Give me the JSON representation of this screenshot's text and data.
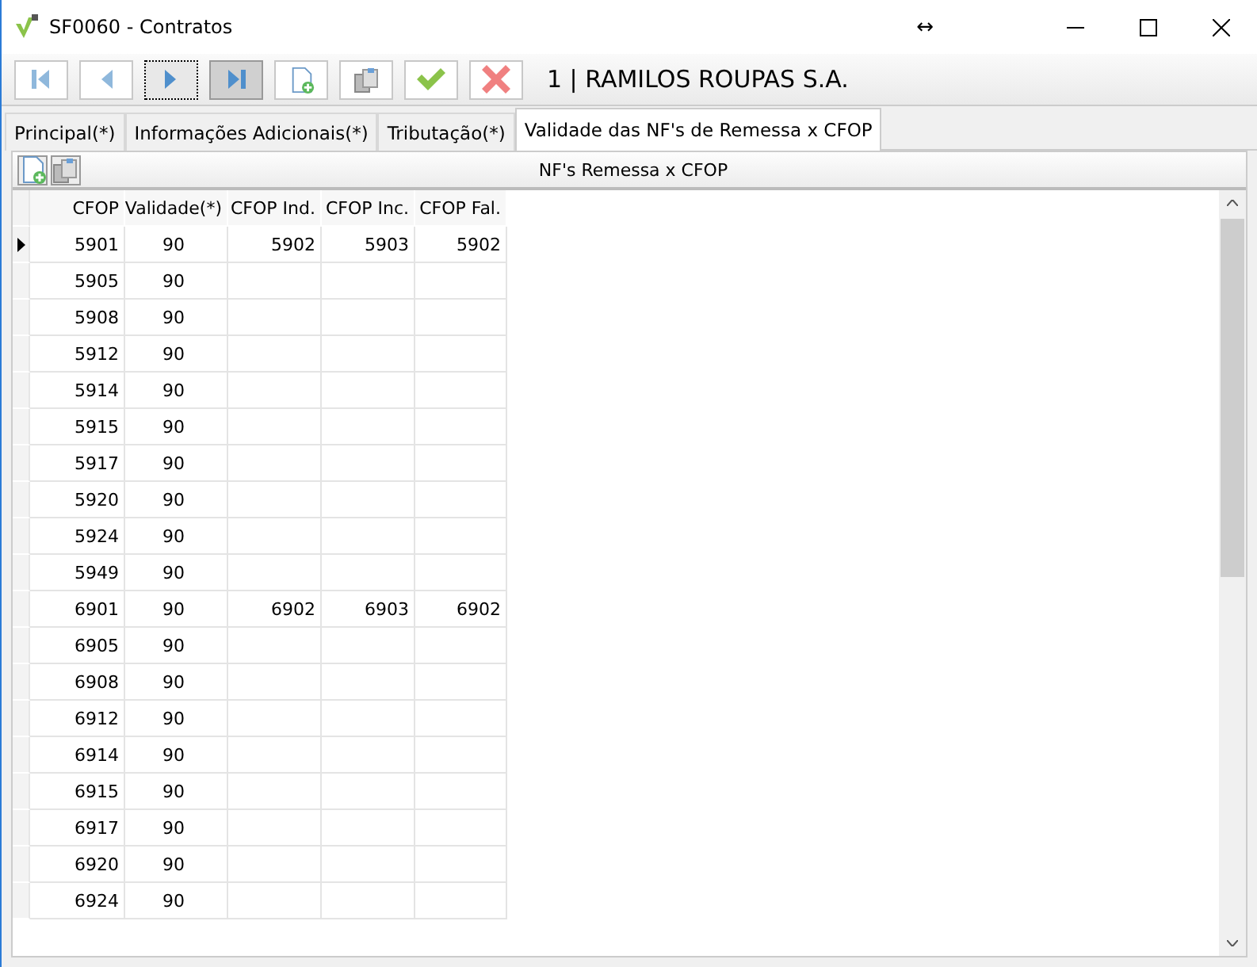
{
  "window": {
    "title": "SF0060 - Contratos",
    "resize_glyph": "↔"
  },
  "toolbar": {
    "buttons": [
      {
        "kind": "first",
        "focused": false,
        "pressed": false
      },
      {
        "kind": "prev",
        "focused": false,
        "pressed": false
      },
      {
        "kind": "next",
        "focused": true,
        "pressed": false
      },
      {
        "kind": "last",
        "focused": false,
        "pressed": true
      },
      {
        "kind": "new",
        "focused": false,
        "pressed": false
      },
      {
        "kind": "copy",
        "focused": false,
        "pressed": false
      },
      {
        "kind": "confirm",
        "focused": false,
        "pressed": false
      },
      {
        "kind": "cancel",
        "focused": false,
        "pressed": false
      }
    ],
    "record": "1 | RAMILOS ROUPAS S.A."
  },
  "tabs": [
    {
      "label": "Principal(*)",
      "selected": false
    },
    {
      "label": "Informações Adicionais(*)",
      "selected": false
    },
    {
      "label": "Tributação(*)",
      "selected": false
    },
    {
      "label": "Validade das NF's de Remessa x CFOP",
      "selected": true
    }
  ],
  "panel": {
    "tools": [
      {
        "kind": "new"
      },
      {
        "kind": "copy"
      }
    ],
    "title": "NF's Remessa x CFOP"
  },
  "table": {
    "columns": [
      "CFOP",
      "Validade(*)",
      "CFOP Ind.",
      "CFOP Inc.",
      "CFOP Fal."
    ],
    "rows": [
      {
        "current": true,
        "cells": [
          "5901",
          "90",
          "5902",
          "5903",
          "5902"
        ]
      },
      {
        "current": false,
        "cells": [
          "5905",
          "90",
          "",
          "",
          ""
        ]
      },
      {
        "current": false,
        "cells": [
          "5908",
          "90",
          "",
          "",
          ""
        ]
      },
      {
        "current": false,
        "cells": [
          "5912",
          "90",
          "",
          "",
          ""
        ]
      },
      {
        "current": false,
        "cells": [
          "5914",
          "90",
          "",
          "",
          ""
        ]
      },
      {
        "current": false,
        "cells": [
          "5915",
          "90",
          "",
          "",
          ""
        ]
      },
      {
        "current": false,
        "cells": [
          "5917",
          "90",
          "",
          "",
          ""
        ]
      },
      {
        "current": false,
        "cells": [
          "5920",
          "90",
          "",
          "",
          ""
        ]
      },
      {
        "current": false,
        "cells": [
          "5924",
          "90",
          "",
          "",
          ""
        ]
      },
      {
        "current": false,
        "cells": [
          "5949",
          "90",
          "",
          "",
          ""
        ]
      },
      {
        "current": false,
        "cells": [
          "6901",
          "90",
          "6902",
          "6903",
          "6902"
        ]
      },
      {
        "current": false,
        "cells": [
          "6905",
          "90",
          "",
          "",
          ""
        ]
      },
      {
        "current": false,
        "cells": [
          "6908",
          "90",
          "",
          "",
          ""
        ]
      },
      {
        "current": false,
        "cells": [
          "6912",
          "90",
          "",
          "",
          ""
        ]
      },
      {
        "current": false,
        "cells": [
          "6914",
          "90",
          "",
          "",
          ""
        ]
      },
      {
        "current": false,
        "cells": [
          "6915",
          "90",
          "",
          "",
          ""
        ]
      },
      {
        "current": false,
        "cells": [
          "6917",
          "90",
          "",
          "",
          ""
        ]
      },
      {
        "current": false,
        "cells": [
          "6920",
          "90",
          "",
          "",
          ""
        ]
      },
      {
        "current": false,
        "cells": [
          "6924",
          "90",
          "",
          "",
          ""
        ]
      }
    ]
  }
}
